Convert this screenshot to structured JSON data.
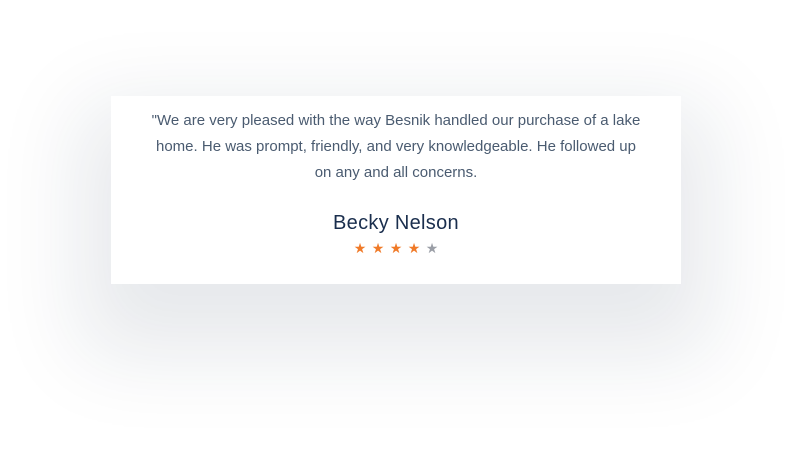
{
  "testimonial": {
    "quote": "\"We are very pleased with the way Besnik handled our purchase of a lake home. He was prompt, friendly, and very knowledgeable. He followed up on any and all concerns.",
    "author": "Becky Nelson",
    "rating": 4,
    "rating_max": 5,
    "star_glyph": "★",
    "colors": {
      "star_filled": "#f07a28",
      "star_empty": "#9a9ea6"
    }
  }
}
